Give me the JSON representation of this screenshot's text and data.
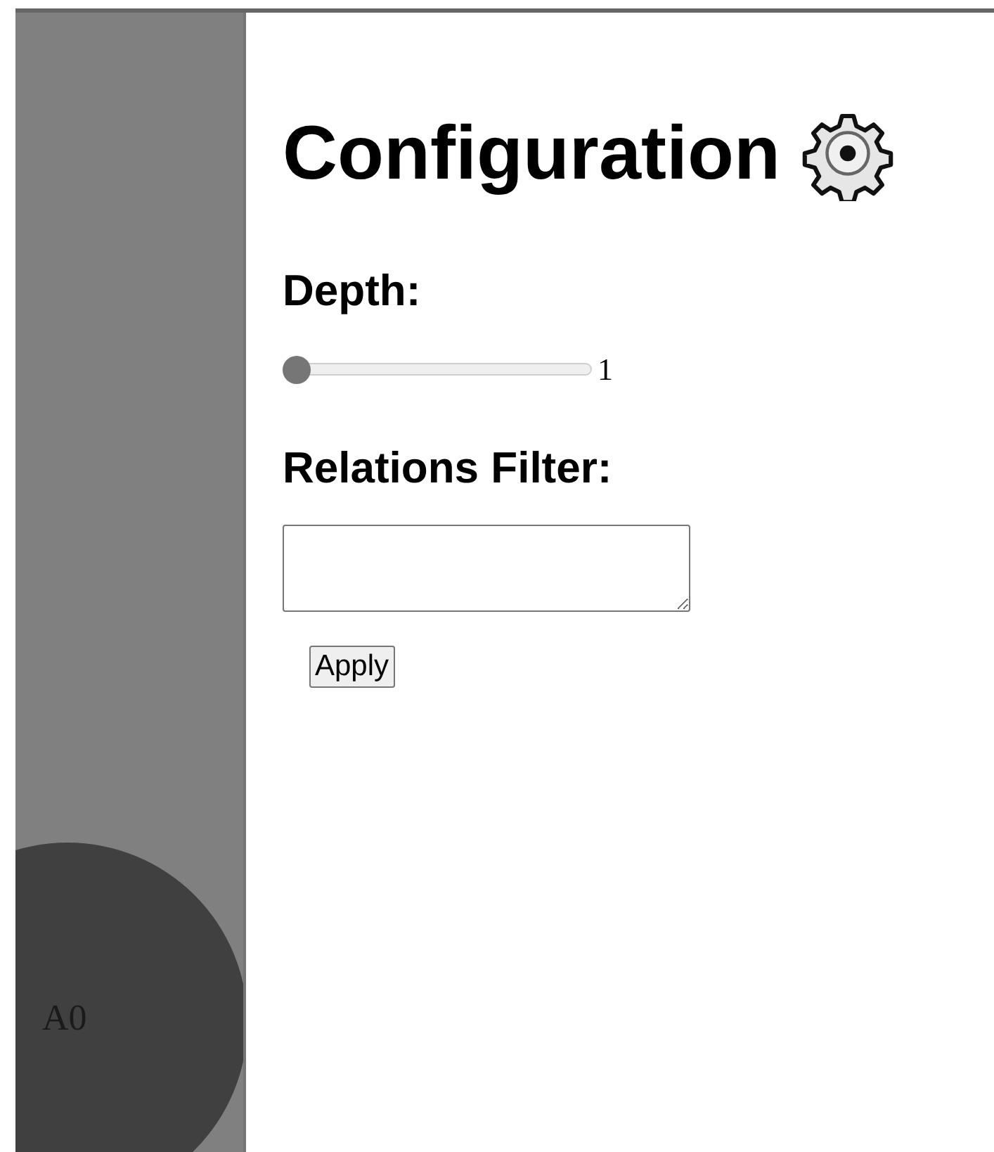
{
  "graph": {
    "nodes": [
      {
        "label": "A0"
      }
    ]
  },
  "config": {
    "title": "Configuration",
    "depth": {
      "label": "Depth:",
      "level": 0,
      "reading": "1"
    },
    "filter": {
      "label": "Relations Filter:"
    },
    "apply_button": "Apply"
  }
}
